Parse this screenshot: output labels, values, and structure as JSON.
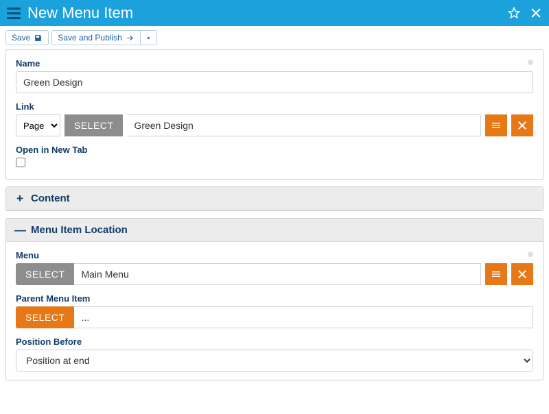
{
  "titlebar": {
    "title": "New Menu Item"
  },
  "toolbar": {
    "save_label": "Save",
    "save_publish_label": "Save and Publish"
  },
  "general": {
    "name_label": "Name",
    "name_value": "Green Design",
    "link_label": "Link",
    "link_type": "Page",
    "link_select_label": "SELECT",
    "link_value": "Green Design",
    "open_new_tab_label": "Open in New Tab",
    "open_new_tab_checked": false
  },
  "sections": {
    "content_title": "Content",
    "location_title": "Menu Item Location"
  },
  "location": {
    "menu_label": "Menu",
    "menu_select_label": "SELECT",
    "menu_value": "Main Menu",
    "parent_label": "Parent Menu Item",
    "parent_select_label": "SELECT",
    "parent_value": "...",
    "position_label": "Position Before",
    "position_value": "Position at end"
  }
}
